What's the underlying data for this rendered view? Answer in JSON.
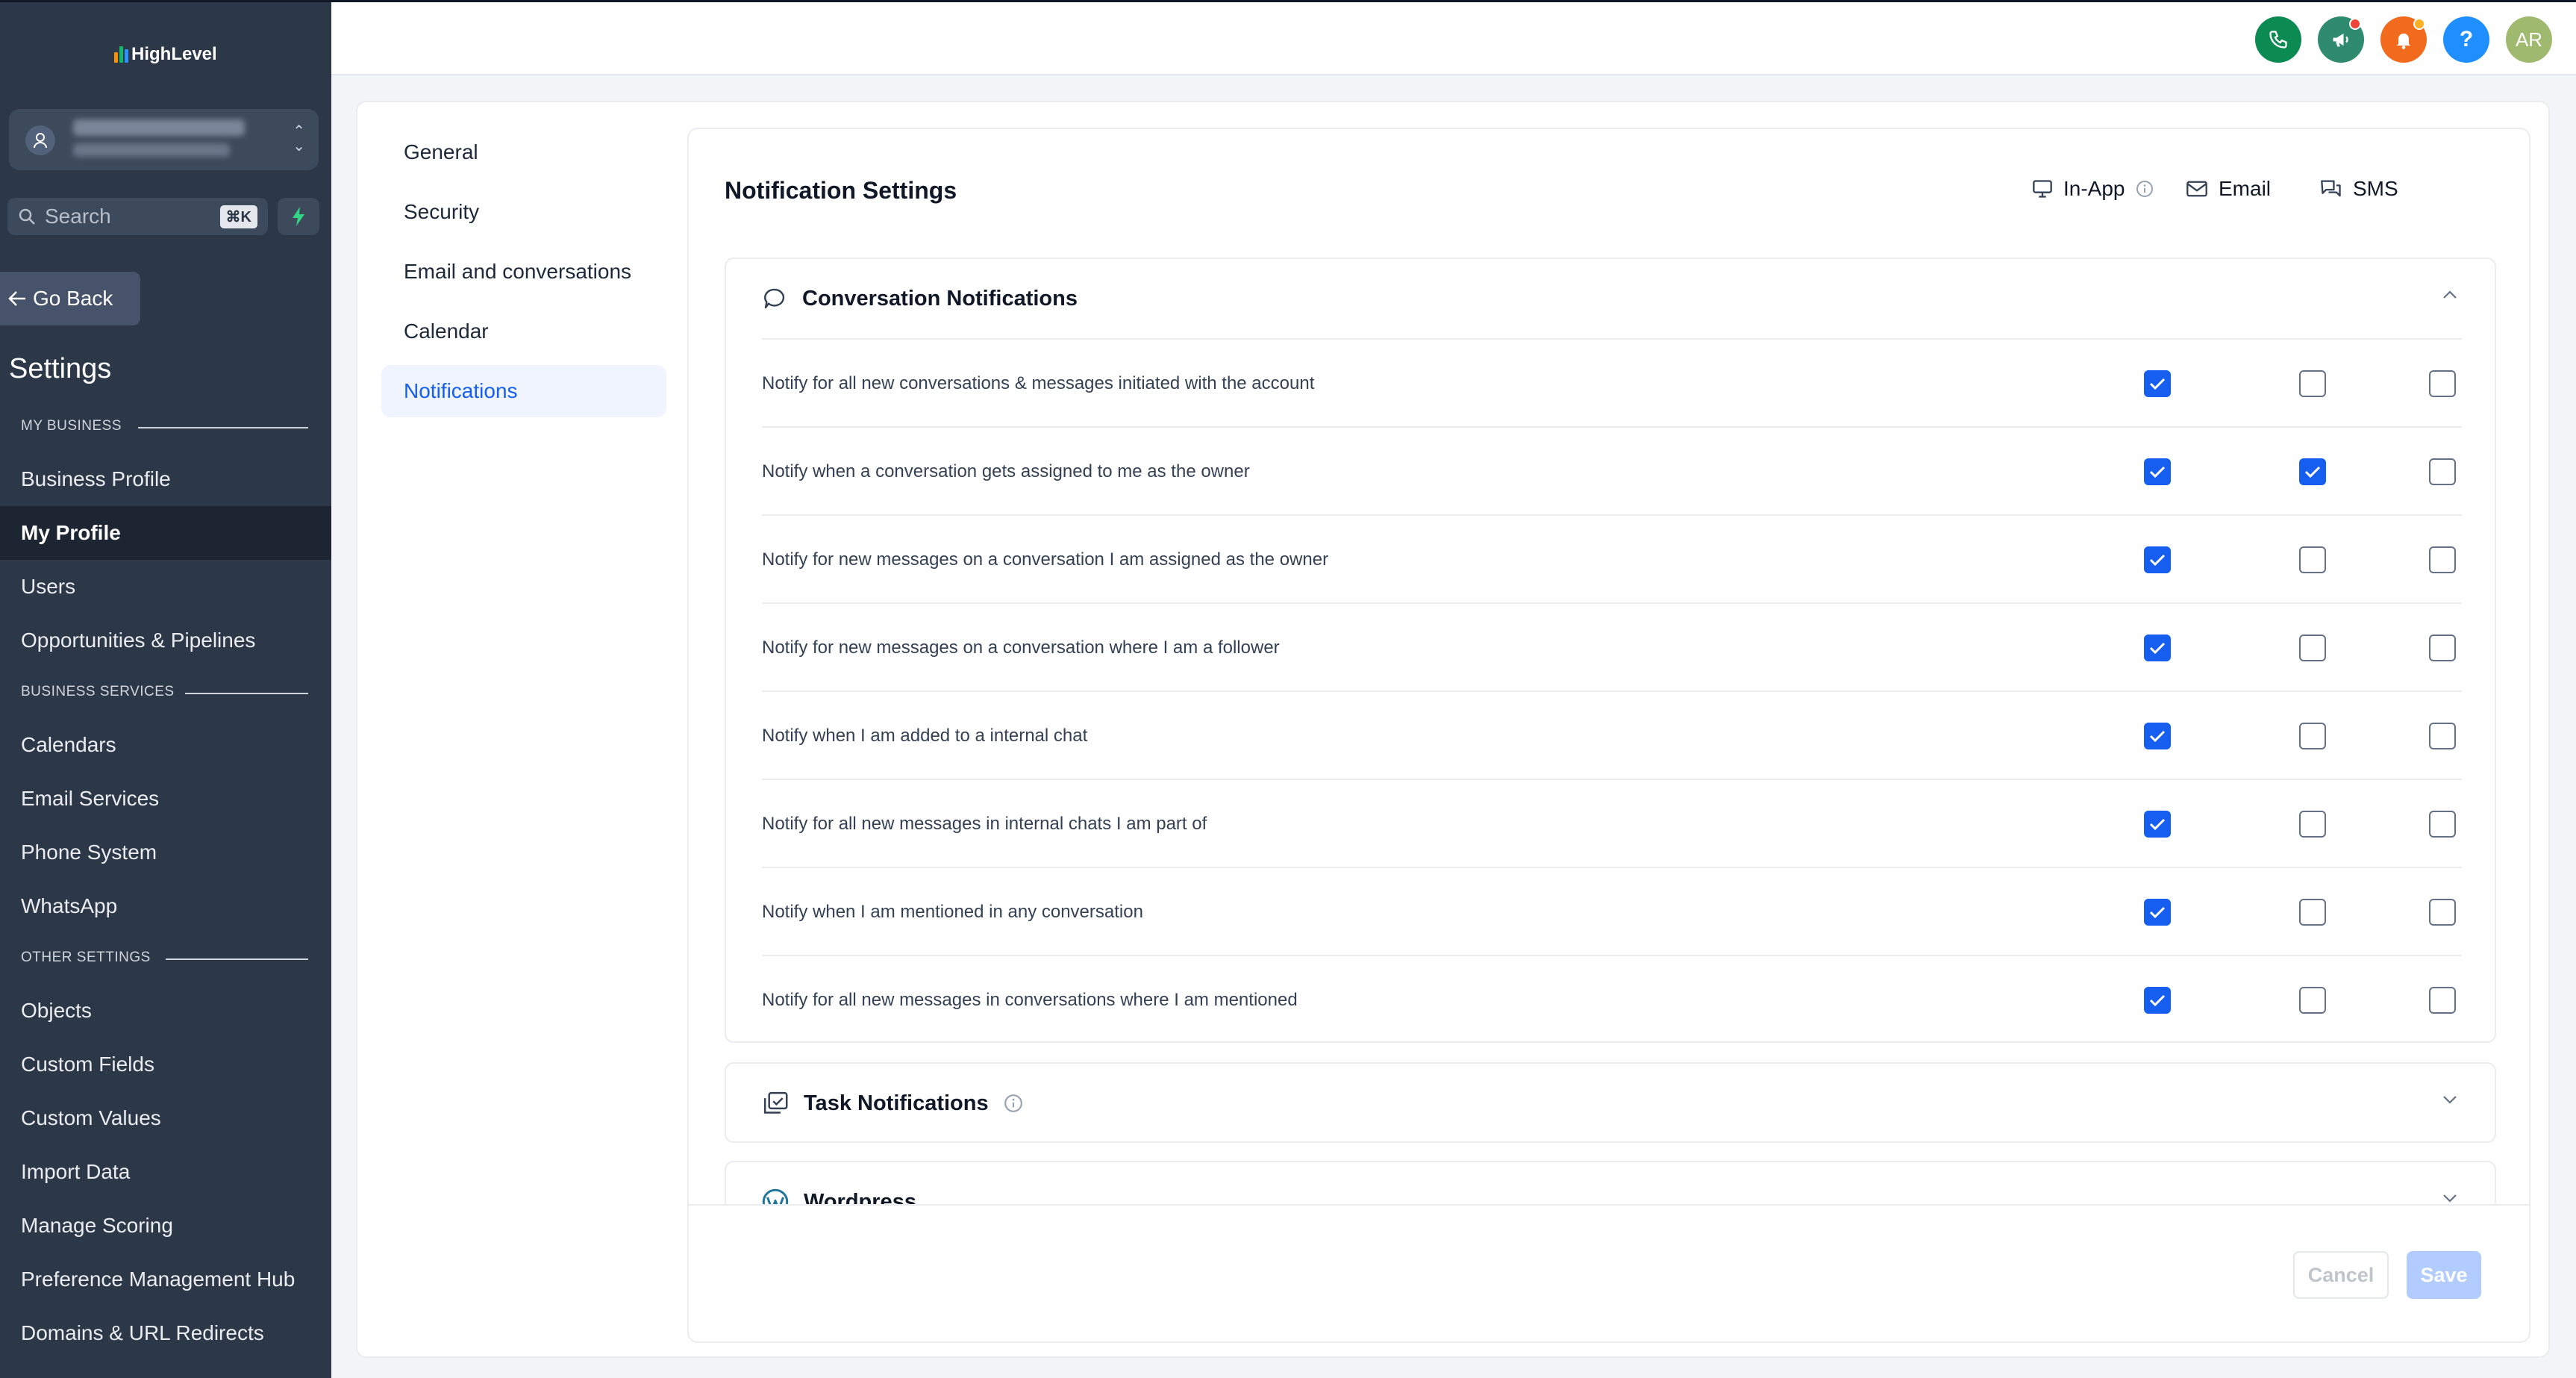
{
  "app": {
    "logo_text": "HighLevel"
  },
  "sidebar": {
    "search_placeholder": "Search",
    "search_shortcut": "⌘K",
    "go_back": "Go Back",
    "title": "Settings",
    "sections": [
      {
        "heading": "MY BUSINESS",
        "items": [
          "Business Profile",
          "My Profile",
          "Users",
          "Opportunities & Pipelines"
        ]
      },
      {
        "heading": "BUSINESS SERVICES",
        "items": [
          "Calendars",
          "Email Services",
          "Phone System",
          "WhatsApp"
        ]
      },
      {
        "heading": "OTHER SETTINGS",
        "items": [
          "Objects",
          "Custom Fields",
          "Custom Values",
          "Import Data",
          "Manage Scoring",
          "Preference Management Hub",
          "Domains & URL Redirects"
        ]
      }
    ],
    "active_item": "My Profile"
  },
  "topbar": {
    "avatar_initials": "AR",
    "help_label": "?"
  },
  "subnav": {
    "items": [
      "General",
      "Security",
      "Email and conversations",
      "Calendar",
      "Notifications"
    ],
    "active": "Notifications"
  },
  "notifications": {
    "title": "Notification Settings",
    "channels": [
      "In-App",
      "Email",
      "SMS"
    ],
    "groups": [
      {
        "title": "Conversation Notifications",
        "expanded": true,
        "rows": [
          {
            "label": "Notify for all new conversations & messages initiated with the account",
            "in_app": true,
            "email": false,
            "sms": false
          },
          {
            "label": "Notify when a conversation gets assigned to me as the owner",
            "in_app": true,
            "email": true,
            "sms": false
          },
          {
            "label": "Notify for new messages on a conversation I am assigned as the owner",
            "in_app": true,
            "email": false,
            "sms": false
          },
          {
            "label": "Notify for new messages on a conversation where I am a follower",
            "in_app": true,
            "email": false,
            "sms": false
          },
          {
            "label": "Notify when I am added to a internal chat",
            "in_app": true,
            "email": false,
            "sms": false
          },
          {
            "label": "Notify for all new messages in internal chats I am part of",
            "in_app": true,
            "email": false,
            "sms": false
          },
          {
            "label": "Notify when I am mentioned in any conversation",
            "in_app": true,
            "email": false,
            "sms": false
          },
          {
            "label": "Notify for all new messages in conversations where I am mentioned",
            "in_app": true,
            "email": false,
            "sms": false
          }
        ]
      },
      {
        "title": "Task Notifications",
        "expanded": false
      },
      {
        "title": "Wordpress",
        "expanded": false
      }
    ],
    "cancel_label": "Cancel",
    "save_label": "Save"
  },
  "colors": {
    "sidebar_bg": "#2c3748",
    "accent": "#155eef",
    "phone_btn": "#0b8a52",
    "announce_btn": "#2e8b6d",
    "bell_btn": "#f26a1b",
    "help_btn": "#1f8fff",
    "avatar_bg": "#9fb96f"
  },
  "icons": {
    "phone": "phone-icon",
    "announcement": "megaphone-icon",
    "notifications": "bell-icon",
    "help": "help-icon",
    "in_app": "monitor-icon",
    "email": "mail-icon",
    "sms": "chat-bubbles-icon",
    "conversation": "chat-bubble-icon",
    "task": "task-check-icon",
    "wordpress": "wordpress-icon"
  }
}
